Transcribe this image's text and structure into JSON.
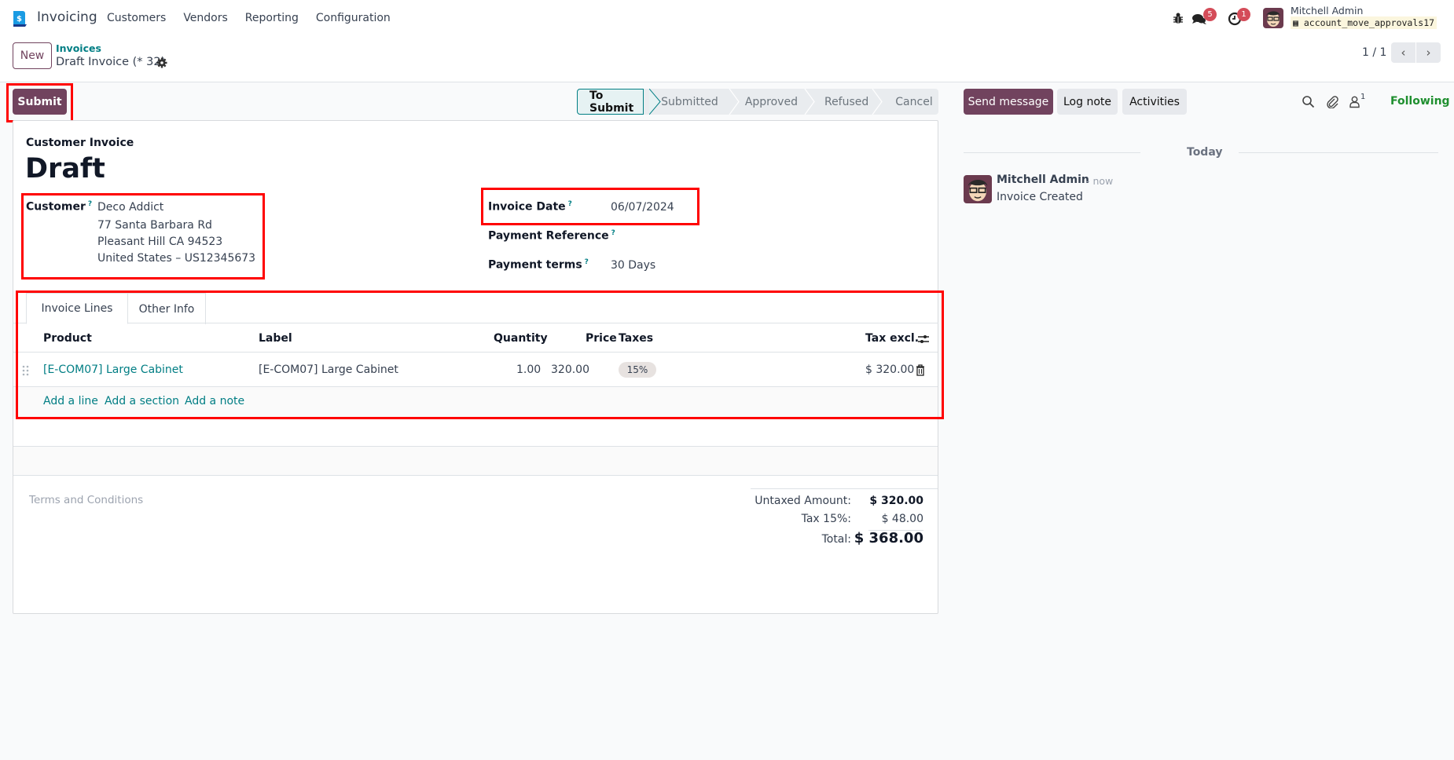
{
  "navbar": {
    "app_name": "Invoicing",
    "menu": [
      "Customers",
      "Vendors",
      "Reporting",
      "Configuration"
    ],
    "messages_badge": "5",
    "activities_badge": "1",
    "user_name": "Mitchell Admin",
    "database": "account_move_approvals17"
  },
  "control_panel": {
    "new_label": "New",
    "breadcrumb_parent": "Invoices",
    "breadcrumb_current": "Draft Invoice (* 32)",
    "pager": "1 / 1"
  },
  "actions": {
    "submit_label": "Submit"
  },
  "statusbar": {
    "stages": [
      "To Submit",
      "Submitted",
      "Approved",
      "Refused",
      "Cancel"
    ],
    "active": "To Submit"
  },
  "form": {
    "move_type": "Customer Invoice",
    "state": "Draft",
    "customer_label": "Customer",
    "customer_name": "Deco Addict",
    "customer_address": [
      "77 Santa Barbara Rd",
      "Pleasant Hill CA 94523",
      "United States – US12345673"
    ],
    "invoice_date_label": "Invoice Date",
    "invoice_date": "06/07/2024",
    "payment_reference_label": "Payment Reference",
    "payment_reference": "",
    "payment_terms_label": "Payment terms",
    "payment_terms": "30 Days",
    "help_marker": "?"
  },
  "tabs": [
    "Invoice Lines",
    "Other Info"
  ],
  "lines": {
    "headers": {
      "product": "Product",
      "label": "Label",
      "quantity": "Quantity",
      "price": "Price",
      "taxes": "Taxes",
      "subtotal": "Tax excl."
    },
    "rows": [
      {
        "product": "[E-COM07] Large Cabinet",
        "label": "[E-COM07] Large Cabinet",
        "quantity": "1.00",
        "price": "320.00",
        "taxes": "15%",
        "subtotal": "$ 320.00"
      }
    ],
    "add_line": "Add a line",
    "add_section": "Add a section",
    "add_note": "Add a note"
  },
  "terms_placeholder": "Terms and Conditions",
  "totals": {
    "untaxed_label": "Untaxed Amount:",
    "untaxed": "$ 320.00",
    "tax_label": "Tax 15%:",
    "tax": "$ 48.00",
    "total_label": "Total:",
    "total": "$ 368.00"
  },
  "chatter": {
    "send_message": "Send message",
    "log_note": "Log note",
    "activities": "Activities",
    "followers_count": "1",
    "following": "Following",
    "date_separator": "Today",
    "messages": [
      {
        "author": "Mitchell Admin",
        "time": "- now",
        "body": "Invoice Created"
      }
    ]
  },
  "colors": {
    "primary": "#71435e",
    "link": "#017e84",
    "highlight": "#ff0000",
    "following": "#1f8f2f"
  }
}
